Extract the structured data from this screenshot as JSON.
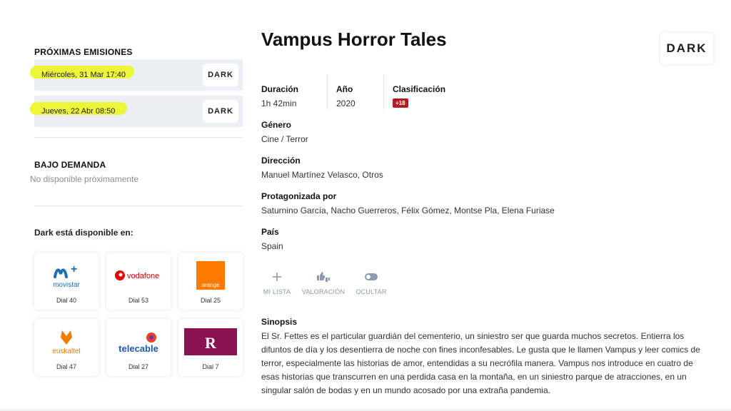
{
  "left": {
    "emissions_title": "PRÓXIMAS EMISIONES",
    "emissions": [
      {
        "date": "Miércoles, 31 Mar 17:40",
        "channel": "DARK"
      },
      {
        "date": "Jueves, 22 Abr 08:50",
        "channel": "DARK"
      }
    ],
    "demand_title": "BAJO DEMANDA",
    "demand_text": "No disponible próximamente",
    "available_title": "Dark está disponible en:",
    "providers": [
      {
        "name": "movistar",
        "brand": "movistar+",
        "dial": "Dial 40"
      },
      {
        "name": "vodafone",
        "brand": "vodafone",
        "dial": "Dial 53"
      },
      {
        "name": "orange",
        "brand": "orange",
        "dial": "Dial 25"
      },
      {
        "name": "euskaltel",
        "brand": "euskaltel",
        "dial": "Dial 47"
      },
      {
        "name": "telecable",
        "brand": "telecable",
        "dial": "Dial 27"
      },
      {
        "name": "r",
        "brand": "R",
        "dial": "Dial 7"
      }
    ]
  },
  "main": {
    "title": "Vampus Horror Tales",
    "channel_logo": "DARK",
    "duration_label": "Duración",
    "duration": "1h 42min",
    "year_label": "Año",
    "year": "2020",
    "rating_label": "Clasificación",
    "rating": "+18",
    "genre_label": "Género",
    "genre": "Cine / Terror",
    "director_label": "Dirección",
    "director": "Manuel Martínez Velasco, Otros",
    "cast_label": "Protagonizada por",
    "cast": "Saturnino García, Nacho Guerreros, Félix Gómez, Montse Pla, Elena Furiase",
    "country_label": "País",
    "country": "Spain",
    "actions": {
      "my_list": "MI LISTA",
      "rating": "VALORACIÓN",
      "hide": "OCULTAR"
    },
    "synopsis_label": "Sinopsis",
    "synopsis": "El Sr. Fettes es el particular guardián del cementerio, un siniestro ser que guarda muchos secretos. Entierra los difuntos de día y los desentierra de noche con fines inconfesables. Le gusta que le llamen Vampus y leer comics de terror, especialmente las historias de amor, entendidas a su necrófila manera. Vampus nos introduce en cuatro de esas historias que transcurren en una perdida casa en la montaña, en un siniestro parque de atracciones, en un singular salón de bodas y en un mundo acosado por una extraña pandemia."
  },
  "colors": {
    "highlight": "#eef52f",
    "emission_bg": "#ecf0f6",
    "rating_badge": "#b81c22",
    "action_icon": "#8a99ab"
  }
}
